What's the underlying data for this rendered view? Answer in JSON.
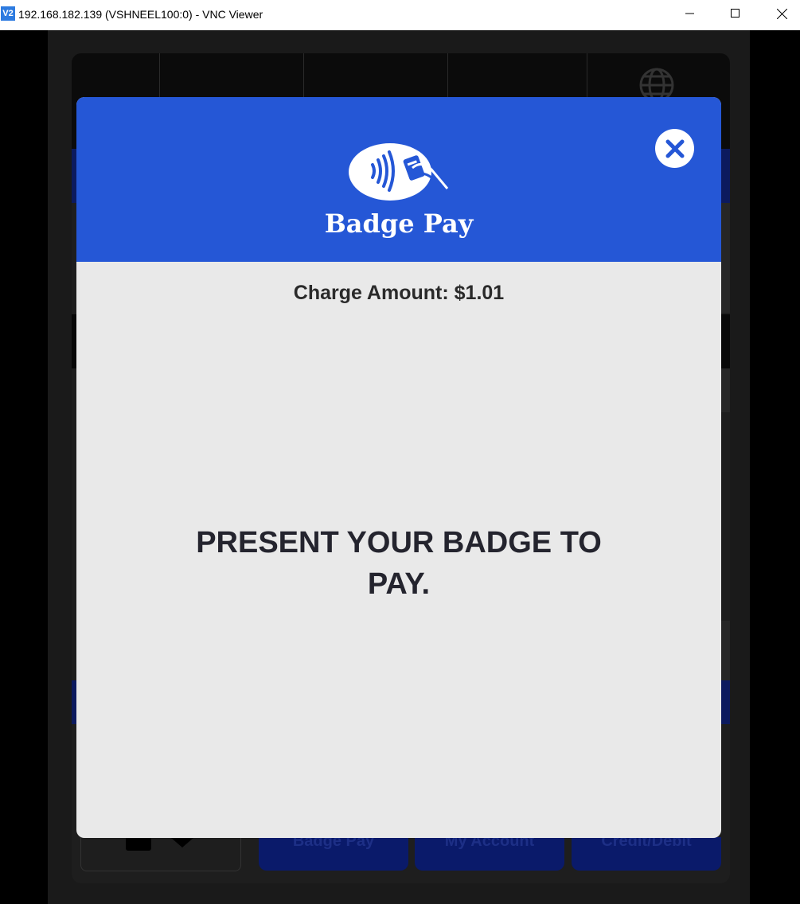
{
  "window": {
    "app_icon_text": "V2",
    "title": "192.168.182.139 (VSHNEEL100:0) - VNC Viewer"
  },
  "modal": {
    "title": "Badge Pay",
    "charge_label": "Charge Amount:",
    "charge_value": "$1.01",
    "prompt": "PRESENT YOUR BADGE TO PAY.",
    "accent_color": "#2557d6",
    "background_color": "#e9e9e9"
  },
  "footer": {
    "buttons": [
      "Badge Pay",
      "My Account",
      "Credit/Debit"
    ]
  }
}
